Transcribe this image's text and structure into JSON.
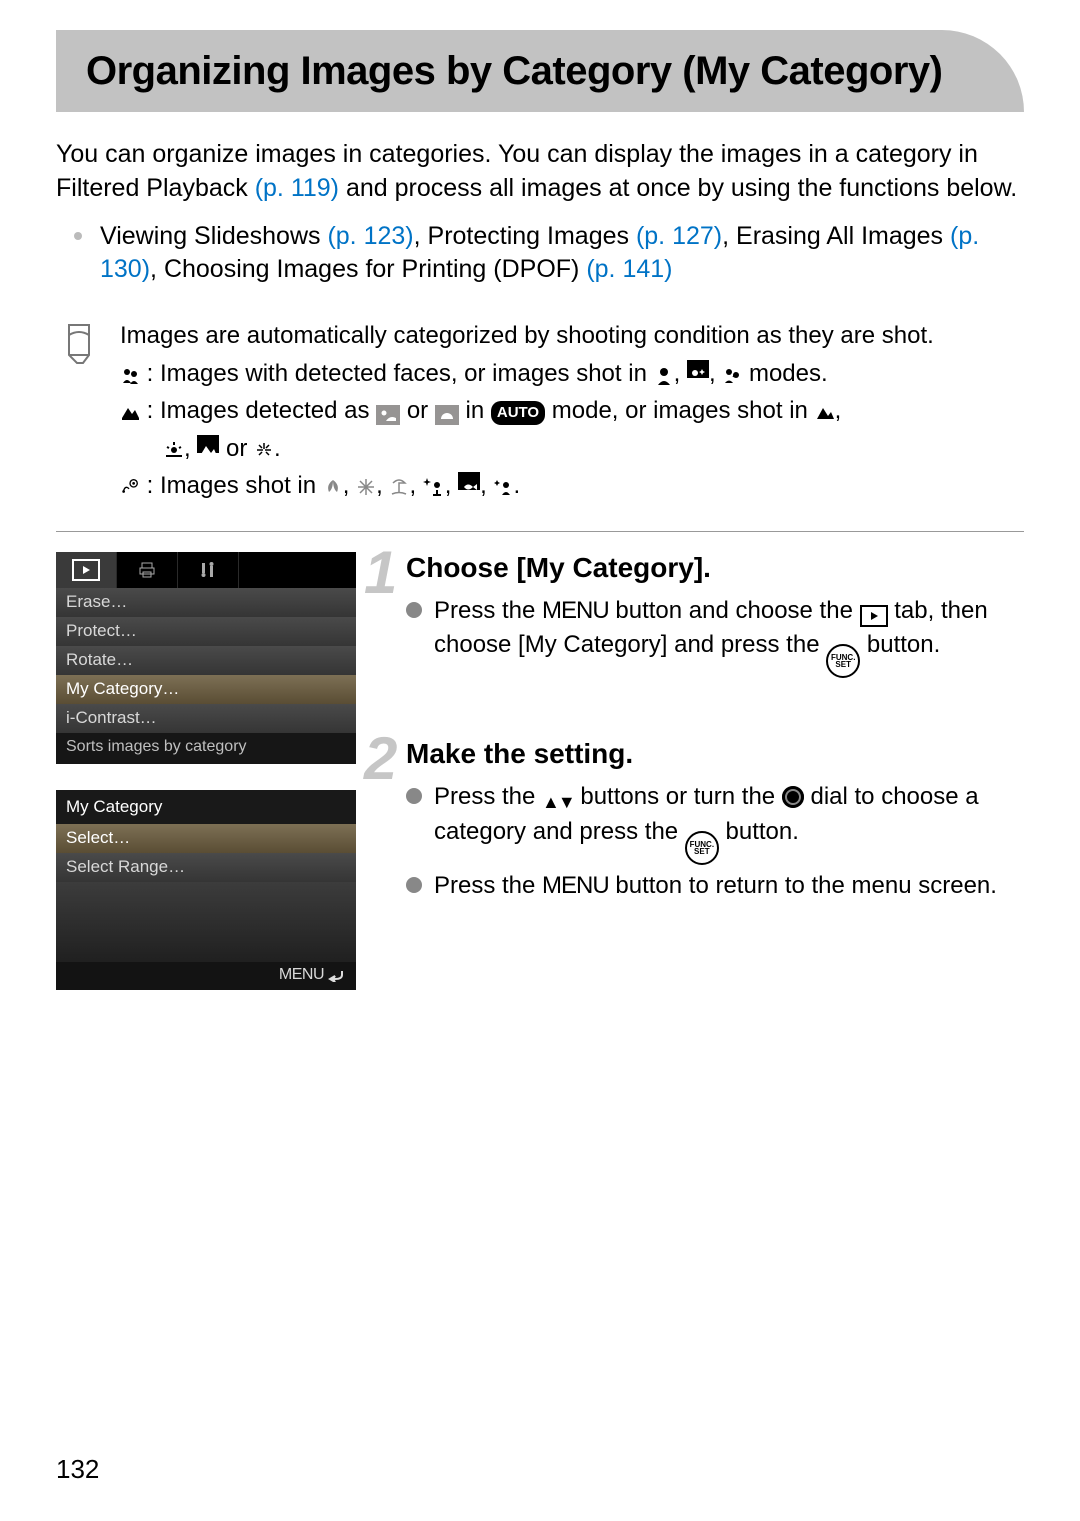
{
  "title": "Organizing Images by Category (My Category)",
  "intro_pre": "You can organize images in categories. You can display the images in a category in Filtered Playback ",
  "intro_link1": "(p. 119)",
  "intro_post": " and process all images at once by using the functions below.",
  "func_list": {
    "slideshows": "Viewing Slideshows ",
    "slideshows_link": "(p. 123)",
    "protect": ", Protecting Images ",
    "protect_link": "(p. 127)",
    "erase": ", Erasing All Images ",
    "erase_link": "(p. 130)",
    "dpof": ", Choosing Images for Printing (DPOF) ",
    "dpof_link": "(p. 141)"
  },
  "note": {
    "intro": "Images are automatically categorized by shooting condition as they are shot.",
    "faces_a": " : Images with detected faces, or images shot in ",
    "faces_b": " modes.",
    "scenery_a": " : Images detected as ",
    "scenery_b": " or ",
    "scenery_c": " in ",
    "scenery_d": " mode, or images shot in ",
    "scenery_e": " or ",
    "events_a": " : Images shot in ",
    "auto_label": "AUTO"
  },
  "steps": [
    {
      "num": "1",
      "title": "Choose [My Category].",
      "b1_a": "Press the ",
      "b1_menu": "MENU",
      "b1_b": " button and choose the ",
      "b1_c": " tab, then choose [My Category] and press the ",
      "b1_d": " button.",
      "funcset_top": "FUNC.",
      "funcset_bot": "SET"
    },
    {
      "num": "2",
      "title": "Make the setting.",
      "b1_a": "Press the ",
      "b1_b": " buttons or turn the ",
      "b1_c": " dial to choose a category and press the ",
      "b1_d": " button.",
      "b2_a": "Press the ",
      "b2_menu": "MENU",
      "b2_b": " button to return to the menu screen.",
      "funcset_top": "FUNC.",
      "funcset_bot": "SET"
    }
  ],
  "screen1": {
    "rows": [
      "Erase…",
      "Protect…",
      "Rotate…",
      "My Category…",
      "i-Contrast…"
    ],
    "desc": "Sorts images by category"
  },
  "screen2": {
    "header": "My Category",
    "rows": [
      "Select…",
      "Select Range…"
    ],
    "foot": "MENU"
  },
  "page_number": "132"
}
